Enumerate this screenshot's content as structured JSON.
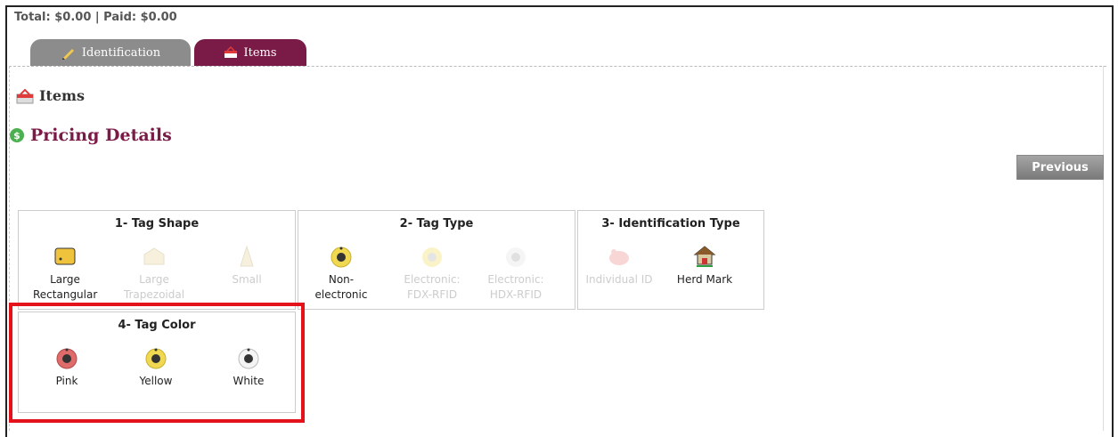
{
  "header": {
    "totals": "Total: $0.00 | Paid: $0.00"
  },
  "tabs": [
    {
      "label": "Identification",
      "icon": "pencil-icon"
    },
    {
      "label": "Items",
      "icon": "cart-icon"
    }
  ],
  "section": {
    "items_title": "Items",
    "pricing_title": "Pricing Details"
  },
  "buttons": {
    "previous": "Previous"
  },
  "panels": {
    "shape": {
      "title": "1- Tag Shape",
      "options": [
        "Large Rectangular",
        "Large Trapezoidal",
        "Small"
      ]
    },
    "type": {
      "title": "2- Tag Type",
      "options": [
        "Non-electronic",
        "Electronic: FDX-RFID",
        "Electronic: HDX-RFID"
      ]
    },
    "ident": {
      "title": "3- Identification Type",
      "options": [
        "Individual ID",
        "Herd Mark"
      ]
    },
    "color": {
      "title": "4- Tag Color",
      "options": [
        "Pink",
        "Yellow",
        "White"
      ]
    }
  },
  "colors": {
    "accent": "#7a1a46",
    "tab_inactive": "#8c8c8c",
    "highlight": "#e3121b",
    "tag_pink": "#e06b6b",
    "tag_yellow": "#f0d850",
    "tag_white": "#f4f4f4"
  }
}
